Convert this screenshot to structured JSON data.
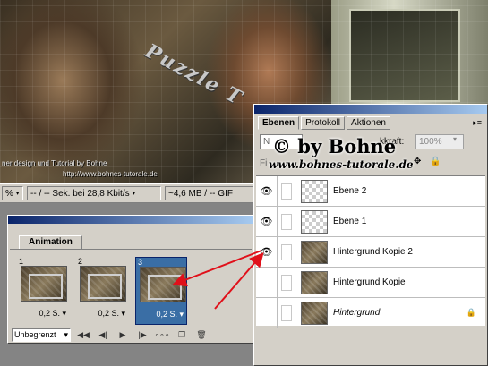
{
  "artwork": {
    "watermark_text": "Puzzle T",
    "credit_line": "ner design und Tutorial by Bohne",
    "credit_url": "http://www.bohnes-tutorale.de"
  },
  "statusbar": {
    "zoom": "%",
    "timing": "-- / -- Sek. bei 28,8 Kbit/s",
    "filesize": "~4,6 MB / -- GIF"
  },
  "animation": {
    "tab_label": "Animation",
    "frames": [
      {
        "number": "1",
        "delay": "0,2 S."
      },
      {
        "number": "2",
        "delay": "0,2 S."
      },
      {
        "number": "3",
        "delay": "0,2 S.",
        "selected": true
      }
    ],
    "loop_option": "Unbegrenzt",
    "controls": [
      "first-frame-icon",
      "previous-frame-icon",
      "play-icon",
      "next-frame-icon",
      "tween-icon",
      "duplicate-frame-icon",
      "delete-frame-icon"
    ]
  },
  "layers_panel": {
    "tabs": [
      "Ebenen",
      "Protokoll",
      "Aktionen"
    ],
    "active_tab": "Ebenen",
    "blend_mode": "N",
    "opacity_label": "kkraft:",
    "opacity_value": "100%",
    "lock_label": "Fi",
    "watermark_by": "© by Bohne",
    "watermark_url": "www.bohnes-tutorale.de",
    "layers": [
      {
        "name": "Ebene 2",
        "visible": true,
        "thumb": "transparent"
      },
      {
        "name": "Ebene 1",
        "visible": true,
        "thumb": "transparent"
      },
      {
        "name": "Hintergrund Kopie 2",
        "visible": true,
        "thumb": "image"
      },
      {
        "name": "Hintergrund Kopie",
        "visible": false,
        "thumb": "image"
      },
      {
        "name": "Hintergrund",
        "visible": false,
        "thumb": "image",
        "italic": true,
        "locked": true
      }
    ]
  },
  "colors": {
    "panel_bg": "#d4d0c8",
    "selection_blue": "#3a6ea5",
    "arrow_red": "#e0101a"
  }
}
